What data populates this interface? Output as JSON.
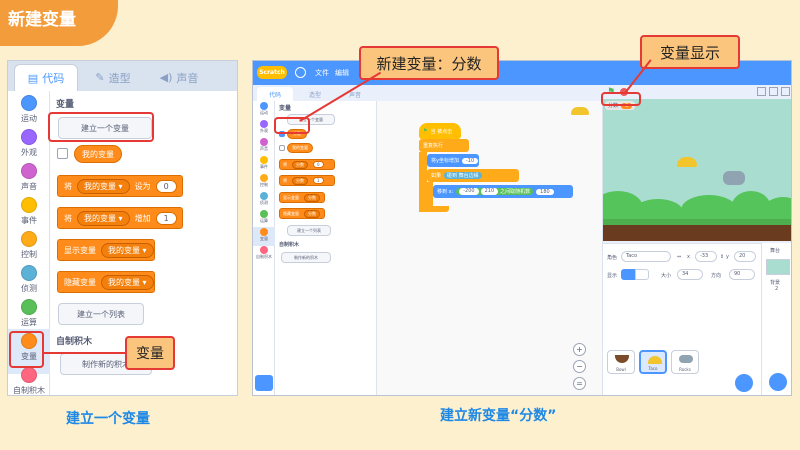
{
  "page": {
    "corner_label": "新建变量",
    "left_caption": "建立一个变量",
    "right_caption": "建立新变量“分数”"
  },
  "left_panel": {
    "tabs": [
      {
        "label": "代码",
        "icon": "code-icon"
      },
      {
        "label": "造型",
        "icon": "brush-icon"
      },
      {
        "label": "声音",
        "icon": "speaker-icon"
      }
    ],
    "categories": [
      {
        "label": "运动",
        "color": "#4c97ff"
      },
      {
        "label": "外观",
        "color": "#9966ff"
      },
      {
        "label": "声音",
        "color": "#cf63cf"
      },
      {
        "label": "事件",
        "color": "#ffbf00"
      },
      {
        "label": "控制",
        "color": "#ffab19"
      },
      {
        "label": "侦测",
        "color": "#5cb1d6"
      },
      {
        "label": "运算",
        "color": "#59c059"
      },
      {
        "label": "变量",
        "color": "#ff8c1a"
      },
      {
        "label": "自制积木",
        "color": "#ff6680"
      }
    ],
    "section_variables": "变量",
    "make_variable_button": "建立一个变量",
    "my_variable": "我的变量",
    "block_set": {
      "p1": "将",
      "var": "我的变量",
      "p2": "设为",
      "value": "0"
    },
    "block_change": {
      "p1": "将",
      "var": "我的变量",
      "p2": "增加",
      "value": "1"
    },
    "block_show": {
      "p1": "显示变量",
      "var": "我的变量"
    },
    "block_hide": {
      "p1": "隐藏变量",
      "var": "我的变量"
    },
    "make_list_button": "建立一个列表",
    "section_my_blocks": "自制积木",
    "make_block_button": "制作新的积木",
    "callout_variable": "变量"
  },
  "right_panel": {
    "logo": "Scratch",
    "menu": [
      "文件",
      "编辑"
    ],
    "tabs": [
      "代码",
      "造型",
      "声音"
    ],
    "categories": [
      {
        "label": "运动",
        "color": "#4c97ff"
      },
      {
        "label": "外观",
        "color": "#9966ff"
      },
      {
        "label": "声音",
        "color": "#cf63cf"
      },
      {
        "label": "事件",
        "color": "#ffbf00"
      },
      {
        "label": "控制",
        "color": "#ffab19"
      },
      {
        "label": "侦测",
        "color": "#5cb1d6"
      },
      {
        "label": "运算",
        "color": "#59c059"
      },
      {
        "label": "变量",
        "color": "#ff8c1a"
      },
      {
        "label": "自制积木",
        "color": "#ff6680"
      }
    ],
    "palette": {
      "section": "变量",
      "make_variable": "建立一个变量",
      "var_score": "分数",
      "var_mine": "我的变量",
      "set_label": "将",
      "set_value": "0",
      "change_label": "将",
      "change_value": "1",
      "show_label": "显示变量",
      "hide_label": "隐藏变量",
      "make_list": "建立一个列表",
      "my_blocks": "自制积木",
      "make_block": "制作新的积木"
    },
    "script": {
      "hat": "当 被点击",
      "forever": "重复执行",
      "b1_label": "将y坐标增加",
      "b1_value": "-10",
      "if_label": "如果",
      "if_touch": "碰到",
      "if_target": "舞台边缘",
      "b3_label": "移到 x:",
      "b3_x": "-200",
      "b3_y": "210",
      "b3_rand": "之间取随机数",
      "b3_max": "180"
    },
    "stage_monitor": {
      "name": "分数",
      "value": "0"
    },
    "sprite_info": {
      "sprite_label": "角色",
      "sprite_name": "Taco",
      "x_label": "x",
      "x_value": "-33",
      "y_label": "y",
      "y_value": "20",
      "show_label": "显示",
      "size_label": "大小",
      "size_value": "34",
      "direction_label": "方向",
      "direction_value": "90"
    },
    "sprites": [
      "Bowl",
      "Taco",
      "Rocks"
    ],
    "stage_pane": {
      "label": "舞台",
      "backdrops_label": "背景",
      "backdrops_count": "2"
    }
  },
  "callouts": {
    "new_variable": "新建变量：分数",
    "variable_display": "变量显示"
  },
  "colors": {
    "background": "#fdf0cf",
    "accent_orange": "#f39c3c",
    "callout_red": "#e53935",
    "caption_blue": "#1e88e5",
    "scratch_blue": "#4c97ff",
    "variable_orange": "#ff8c1a"
  }
}
